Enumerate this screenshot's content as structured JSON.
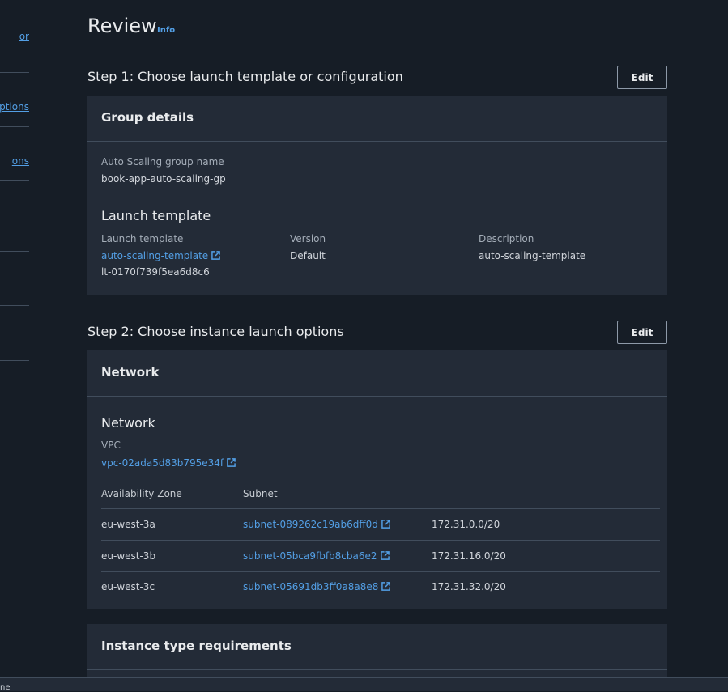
{
  "sidebar": {
    "links": [
      "or",
      "ptions",
      "ons"
    ]
  },
  "page": {
    "title": "Review",
    "info_label": "Info"
  },
  "step1": {
    "title": "Step 1: Choose launch template or configuration",
    "edit_label": "Edit",
    "panel_title": "Group details",
    "asg_name_label": "Auto Scaling group name",
    "asg_name_value": "book-app-auto-scaling-gp",
    "launch_template_heading": "Launch template",
    "lt_label": "Launch template",
    "lt_link": "auto-scaling-template",
    "lt_id": "lt-0170f739f5ea6d8c6",
    "version_label": "Version",
    "version_value": "Default",
    "description_label": "Description",
    "description_value": "auto-scaling-template"
  },
  "step2": {
    "title": "Step 2: Choose instance launch options",
    "edit_label": "Edit",
    "panel_title": "Network",
    "network_heading": "Network",
    "vpc_label": "VPC",
    "vpc_link": "vpc-02ada5d83b795e34f",
    "table_headers": [
      "Availability Zone",
      "Subnet"
    ],
    "rows": [
      {
        "az": "eu-west-3a",
        "subnet": "subnet-089262c19ab6dff0d",
        "cidr": "172.31.0.0/20"
      },
      {
        "az": "eu-west-3b",
        "subnet": "subnet-05bca9fbfb8cba6e2",
        "cidr": "172.31.16.0/20"
      },
      {
        "az": "eu-west-3c",
        "subnet": "subnet-05691db3ff0a8a8e8",
        "cidr": "172.31.32.0/20"
      }
    ]
  },
  "step3": {
    "panel_title": "Instance type requirements"
  },
  "bottom": {
    "text": "ne"
  },
  "icons": {
    "external_link": "external-link-icon"
  },
  "colors": {
    "background": "#161d26",
    "panel": "#232b37",
    "link": "#539fe5",
    "border": "#414d5c"
  }
}
